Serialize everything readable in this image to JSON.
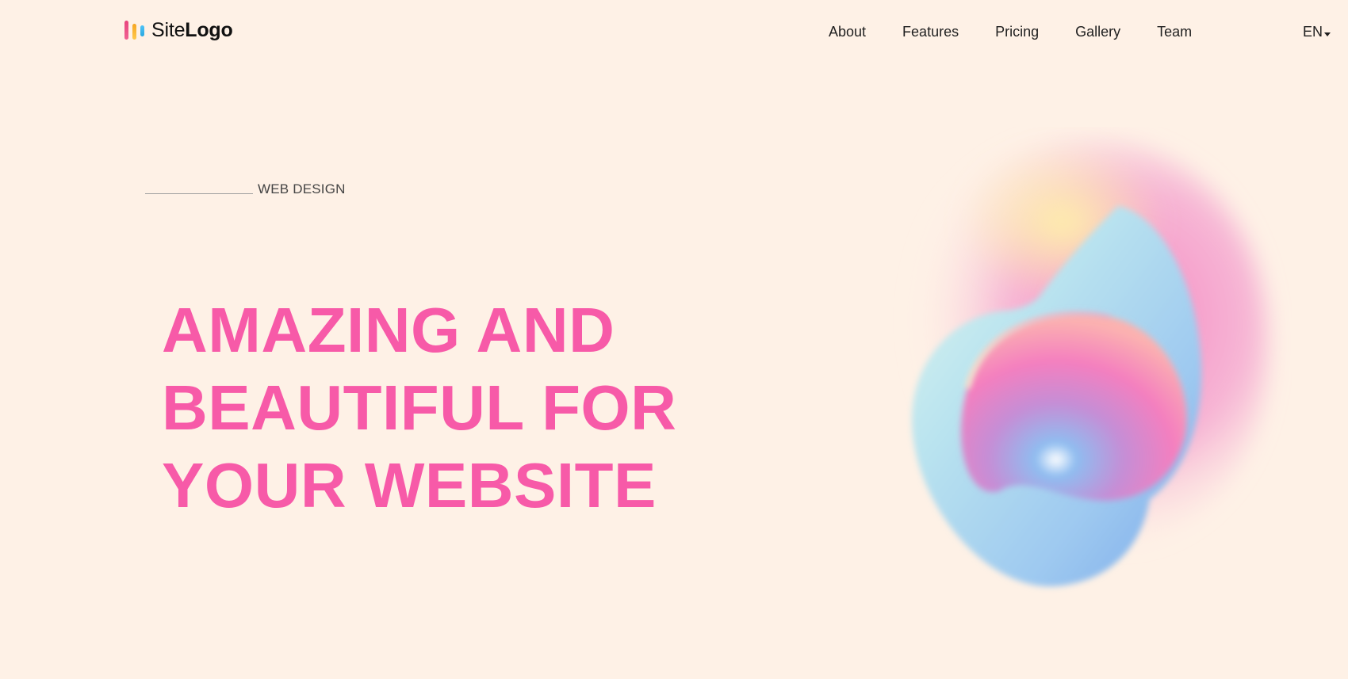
{
  "header": {
    "logo": {
      "site": "Site",
      "brand": "Logo"
    },
    "nav": [
      {
        "label": "About"
      },
      {
        "label": "Features"
      },
      {
        "label": "Pricing"
      },
      {
        "label": "Gallery"
      },
      {
        "label": "Team"
      }
    ],
    "language": "EN"
  },
  "hero": {
    "eyebrow": "WEB DESIGN",
    "headline": [
      "AMAZING AND",
      "BEAUTIFUL FOR",
      "YOUR WEBSITE"
    ]
  },
  "colors": {
    "background": "#fef1e6",
    "accent": "#f75aa8"
  },
  "icons": {
    "logo": "bar-chart-logo-icon",
    "language_dropdown": "caret-down-icon"
  }
}
